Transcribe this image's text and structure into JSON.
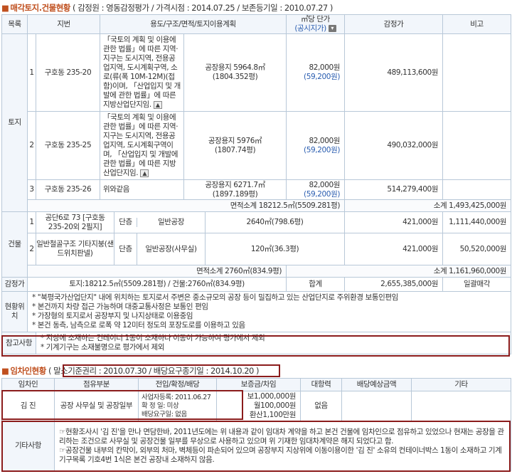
{
  "section1": {
    "title": "매각토지.건물현황",
    "subtitle": "( 감정원 : 영동감정평가 / 가격시점 : 2014.07.25 / 보존등기일 : 2010.07.27 )"
  },
  "headers": {
    "mokrok": "목록",
    "jibeon": "지번",
    "yongdo": "용도/구조/면적/토지이용계획",
    "danga": "㎡당 단가",
    "gongsi": "(공시지가)",
    "gamjeong": "감정가",
    "bigo": "비고"
  },
  "land": {
    "label": "토지",
    "rows": [
      {
        "no": "1",
        "jibeon": "구호동 235-20",
        "plan": "「국토의 계획 및 이용에 관한 법률」에 따른 지역·지구는 도시지역, 전용공업지역, 도시계획구역, 소로(류(폭 10M-12M)(접함)이며, 「산업입지 및 개발에 관한 법률」에 따른 지방산업단지임.",
        "use": "공장용지 5964.8㎡",
        "pyeong": "(1804.352평)",
        "price": "82,000원",
        "gongsi": "(59,200원)",
        "value": "489,113,600원"
      },
      {
        "no": "2",
        "jibeon": "구호동 235-25",
        "plan": "「국토의 계획 및 이용에 관한 법률」에 따른 지역·지구는 도시지역, 전용공업지역, 도시계획구역이며, 「산업입지 및 개발에 관한 법률」에 따른 지방산업단지임.",
        "use": "공장용지 5976㎡",
        "pyeong": "(1807.74평)",
        "price": "82,000원",
        "gongsi": "(59,200원)",
        "value": "490,032,000원"
      },
      {
        "no": "3",
        "jibeon": "구호동 235-26",
        "plan": "위와같음",
        "use": "공장용지 6271.7㎡",
        "pyeong": "(1897.189평)",
        "price": "82,000원",
        "gongsi": "(59,200원)",
        "value": "514,279,400원"
      }
    ],
    "area_subtotal": "면적소계 18212.5㎡(5509.281평)",
    "subtotal": "소계 1,493,425,000원"
  },
  "building": {
    "label": "건물",
    "rows": [
      {
        "no": "1",
        "desc": "공단6로 73 [구호동 235-20외 2필지]",
        "floor": "단층",
        "use": "일반공장",
        "area": "2640㎡(798.6평)",
        "price": "421,000원",
        "value": "1,111,440,000원"
      },
      {
        "no": "2",
        "desc": "일반철골구조 기타지붕(샌드위치판넬)",
        "floor": "단층",
        "use": "일반공장(사무실)",
        "area": "120㎡(36.3평)",
        "price": "421,000원",
        "value": "50,520,000원"
      }
    ],
    "area_subtotal": "면적소계 2760㎡(834.9평)",
    "subtotal": "소계 1,161,960,000원"
  },
  "appraisal": {
    "label": "감정가",
    "summary": "토지:18212.5㎡(5509.281평) / 건물:2760㎡(834.9평)",
    "total_label": "합계",
    "total": "2,655,385,000원",
    "note": "일괄매각"
  },
  "location": {
    "label": "현황위치",
    "lines": [
      "* \"북평국가산업단지\" 내에 위치하는 토지로서 주변은 중소규모의 공장 등이 밀집하고 있는 산업단지로 주위환경 보통인편임",
      "* 본건까지 차량 접근 가능하며 대중교통사정은 보통인 편임",
      "* 가장형의 토지로서 공장부지 및 나지상태로 이용중임",
      "* 본건 동측, 남측으로 로폭 약 12미터 정도의 포장도로를 이용하고 있음"
    ]
  },
  "reference": {
    "label": "참고사항",
    "lines": [
      "* 지상에 소재하는 컨테이너 1동이 소재하나 이동이 가능하여 평가에서 제외",
      "* 기계기구는 소재불명으로 평가에서 제외"
    ]
  },
  "section2": {
    "title": "임차인현황",
    "subtitle": "( 말소기준권리 : 2010.07.30 / 배당요구종기일 : 2014.10.20 )"
  },
  "tenant_headers": {
    "name": "임차인",
    "part": "점유부분",
    "dates": "전입/확정/배당",
    "deposit": "보증금/차임",
    "priority": "대항력",
    "expected": "배당예상금액",
    "etc": "기타"
  },
  "tenant": {
    "name": "김  진",
    "part": "공장 사무실 및 공장일부",
    "date1": "사업자등록: 2011.06.27",
    "date2": "확 정 일: 미상",
    "date3": "배당요구일: 없음",
    "deposit1": "보1,000,000원",
    "deposit2": "월100,000원",
    "deposit3": "환산1,100만원",
    "priority": "없음",
    "expected": "",
    "etc": ""
  },
  "other": {
    "label": "기타사항",
    "lines": [
      "☞현황조사시 '김  진'을 만나 면담한바, 2011년도에는 위 내용과 같이 임대차 계약을 하고 본건 건물에 임차인으로 점유하고 있었으나 현재는 공장을 관리하는 조건으로 사무실 및 공장건물 일부를 무상으로 사용하고 있으며 위 기재한 임대차계약은 해지 되었다고 함.",
      "☞공장건물 내부의 칸막이, 외부의 처마, 벽체등이 파손되어 있으며 공장부지 지상위에 이동이용이한 '김  진' 소유의 컨테이너박스 1동이 소재하고 기계기구목록 기호4번 1식은 본건 공장내 소재하지 않음."
    ]
  }
}
